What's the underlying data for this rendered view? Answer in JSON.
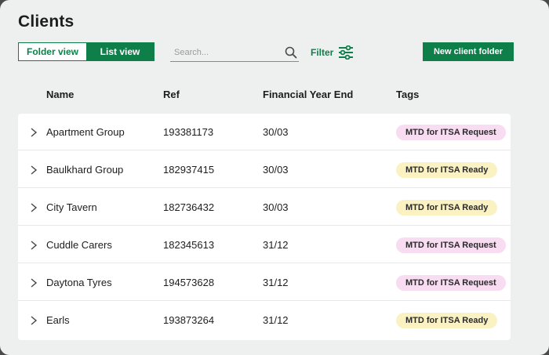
{
  "page": {
    "title": "Clients"
  },
  "toolbar": {
    "folder_view_label": "Folder view",
    "list_view_label": "List view",
    "search_placeholder": "Search...",
    "filter_label": "Filter",
    "new_folder_label": "New client folder"
  },
  "table": {
    "headers": {
      "name": "Name",
      "ref": "Ref",
      "fye": "Financial Year End",
      "tags": "Tags"
    },
    "rows": [
      {
        "name": "Apartment Group",
        "ref": "193381173",
        "fye": "30/03",
        "tag": "MTD for ITSA Request",
        "tag_type": "request"
      },
      {
        "name": "Baulkhard Group",
        "ref": "182937415",
        "fye": "30/03",
        "tag": "MTD for ITSA Ready",
        "tag_type": "ready"
      },
      {
        "name": "City Tavern",
        "ref": "182736432",
        "fye": "30/03",
        "tag": "MTD for ITSA Ready",
        "tag_type": "ready"
      },
      {
        "name": "Cuddle Carers",
        "ref": "182345613",
        "fye": "31/12",
        "tag": "MTD for ITSA Request",
        "tag_type": "request"
      },
      {
        "name": "Daytona Tyres",
        "ref": "194573628",
        "fye": "31/12",
        "tag": "MTD for ITSA Request",
        "tag_type": "request"
      },
      {
        "name": "Earls",
        "ref": "193873264",
        "fye": "31/12",
        "tag": "MTD for ITSA Ready",
        "tag_type": "ready"
      }
    ]
  },
  "colors": {
    "brand_green": "#0f7f4a",
    "tag_request": "#f8dcf2",
    "tag_ready": "#fbf2c4"
  },
  "icons": {
    "search": "search-icon",
    "filter": "sliders-icon",
    "expand": "chevron-right-icon"
  }
}
